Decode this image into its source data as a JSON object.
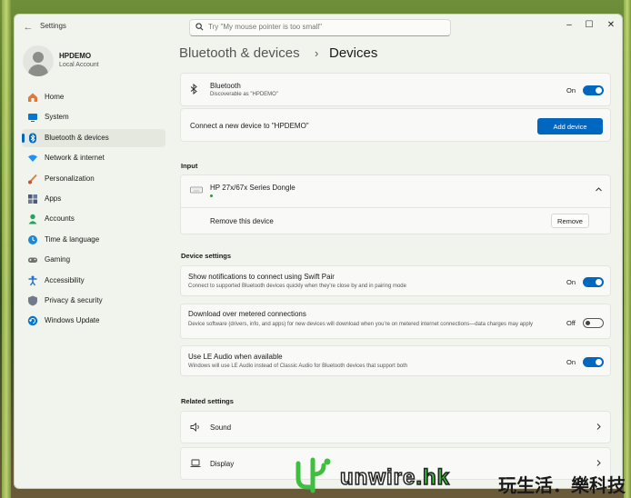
{
  "window": {
    "app_title": "Settings",
    "search_placeholder": "Try \"My mouse pointer is too small\""
  },
  "user": {
    "name": "HPDEMO",
    "account_type": "Local Account"
  },
  "sidebar": {
    "items": [
      {
        "label": "Home",
        "icon": "home-icon",
        "color": "#e07a3a"
      },
      {
        "label": "System",
        "icon": "monitor-icon",
        "color": "#0078d4"
      },
      {
        "label": "Bluetooth & devices",
        "icon": "bluetooth-icon",
        "color": "#0067c0",
        "active": true
      },
      {
        "label": "Network & internet",
        "icon": "wifi-icon",
        "color": "#1e90ff"
      },
      {
        "label": "Personalization",
        "icon": "brush-icon",
        "color": "#e0803a"
      },
      {
        "label": "Apps",
        "icon": "apps-icon",
        "color": "#4a5a78"
      },
      {
        "label": "Accounts",
        "icon": "person-icon",
        "color": "#2aa05a"
      },
      {
        "label": "Time & language",
        "icon": "globe-clock-icon",
        "color": "#1e88d4"
      },
      {
        "label": "Gaming",
        "icon": "gamepad-icon",
        "color": "#707070"
      },
      {
        "label": "Accessibility",
        "icon": "accessibility-icon",
        "color": "#1e6fd0"
      },
      {
        "label": "Privacy & security",
        "icon": "shield-icon",
        "color": "#707a8a"
      },
      {
        "label": "Windows Update",
        "icon": "update-icon",
        "color": "#0078d4"
      }
    ]
  },
  "breadcrumb": {
    "parent": "Bluetooth & devices",
    "separator": "›",
    "current": "Devices"
  },
  "bluetooth": {
    "title": "Bluetooth",
    "subtitle": "Discoverable as \"HPDEMO\"",
    "state": "On"
  },
  "connect": {
    "label": "Connect a new device to \"HPDEMO\"",
    "button": "Add device"
  },
  "input_section": {
    "heading": "Input",
    "device_name": "HP 27x/67x Series Dongle",
    "remove_label": "Remove this device",
    "remove_button": "Remove"
  },
  "device_settings": {
    "heading": "Device settings",
    "items": [
      {
        "title": "Show notifications to connect using Swift Pair",
        "subtitle": "Connect to supported Bluetooth devices quickly when they're close by and in pairing mode",
        "state": "On",
        "on": true
      },
      {
        "title": "Download over metered connections",
        "subtitle": "Device software (drivers, info, and apps) for new devices will download when you're on metered internet connections—data charges may apply",
        "state": "Off",
        "on": false
      },
      {
        "title": "Use LE Audio when available",
        "subtitle": "Windows will use LE Audio instead of Classic Audio for Bluetooth devices that support both",
        "state": "On",
        "on": true
      }
    ]
  },
  "related_settings": {
    "heading": "Related settings",
    "items": [
      {
        "label": "Sound",
        "icon": "speaker-icon"
      },
      {
        "label": "Display",
        "icon": "laptop-icon"
      }
    ]
  },
  "watermark": {
    "brand": "unwire",
    "brand_suffix": ".hk",
    "slogan": "玩生活．樂科技"
  },
  "colors": {
    "accent": "#0067c0",
    "window_bg": "#f1f4ec",
    "card_bg": "#f9faf7",
    "status_green": "#2a9d2a",
    "watermark_green": "#3fbf3f"
  }
}
